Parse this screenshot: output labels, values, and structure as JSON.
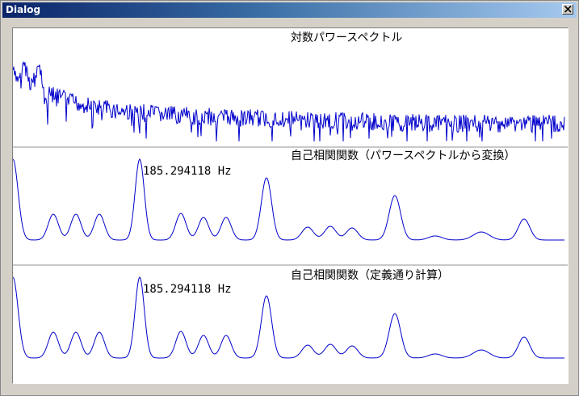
{
  "window": {
    "title": "Dialog"
  },
  "colors": {
    "line": "#0000cc",
    "background": "#ffffff",
    "divider": "#c8c8c8"
  },
  "plots": [
    {
      "title": "対数パワースペクトル"
    },
    {
      "title": "自己相関関数（パワースペクトルから変換）",
      "peak_label": "185.294118 Hz"
    },
    {
      "title": "自己相関関数（定義通り計算）",
      "peak_label": "185.294118 Hz"
    }
  ]
}
